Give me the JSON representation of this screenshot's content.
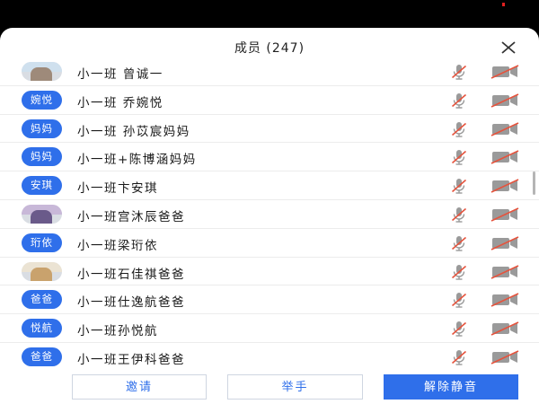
{
  "dialog": {
    "title": "成员 (247)"
  },
  "members": [
    {
      "avatar_text": "",
      "avatar_kind": "photo",
      "name": "小一班 曾诚一"
    },
    {
      "avatar_text": "婉悦",
      "avatar_kind": "text",
      "name": "小一班 乔婉悦"
    },
    {
      "avatar_text": "妈妈",
      "avatar_kind": "text",
      "name": "小一班 孙苡宸妈妈"
    },
    {
      "avatar_text": "妈妈",
      "avatar_kind": "text",
      "name": "小一班+陈博涵妈妈"
    },
    {
      "avatar_text": "安琪",
      "avatar_kind": "text",
      "name": "小一班卞安琪"
    },
    {
      "avatar_text": "",
      "avatar_kind": "photo",
      "name": "小一班宫沐辰爸爸"
    },
    {
      "avatar_text": "珩依",
      "avatar_kind": "text",
      "name": "小一班梁珩依"
    },
    {
      "avatar_text": "",
      "avatar_kind": "photo",
      "name": "小一班石佳祺爸爸"
    },
    {
      "avatar_text": "爸爸",
      "avatar_kind": "text",
      "name": "小一班仕逸航爸爸"
    },
    {
      "avatar_text": "悦航",
      "avatar_kind": "text",
      "name": "小一班孙悦航"
    },
    {
      "avatar_text": "爸爸",
      "avatar_kind": "text",
      "name": "小一班王伊科爸爸"
    }
  ],
  "footer": {
    "invite_label": "邀请",
    "raise_hand_label": "举手",
    "unmute_label": "解除静音"
  },
  "icons": {
    "close": "close-icon",
    "mic_off": "mic-off-icon",
    "camera_off": "camera-off-icon"
  },
  "colors": {
    "accent": "#2f6fea",
    "muted_icon": "#9a9a9a",
    "muted_slash": "#e5533d"
  }
}
